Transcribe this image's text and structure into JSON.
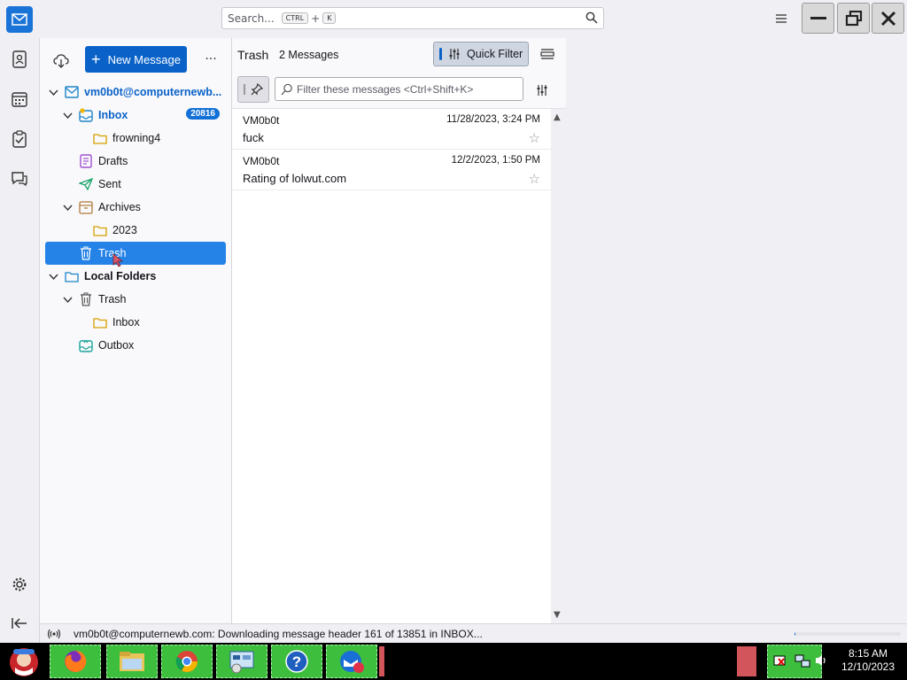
{
  "titlebar": {
    "search_placeholder": "Search...",
    "search_key1": "CTRL",
    "search_plus": "+",
    "search_key2": "K"
  },
  "folder_pane": {
    "new_message_label": "New Message",
    "more_label": "···",
    "folders": [
      {
        "label": "vm0b0t@computernewb...",
        "bold": true
      },
      {
        "label": "Inbox",
        "badge": "20816"
      },
      {
        "label": "frowning4"
      },
      {
        "label": "Drafts"
      },
      {
        "label": "Sent"
      },
      {
        "label": "Archives"
      },
      {
        "label": "2023"
      },
      {
        "label": "Trash",
        "selected": true
      },
      {
        "label": "Local Folders"
      },
      {
        "label": "Trash"
      },
      {
        "label": "Inbox"
      },
      {
        "label": "Outbox"
      }
    ]
  },
  "thread_pane": {
    "folder_title": "Trash",
    "message_count": "2 Messages",
    "quick_filter_label": "Quick Filter",
    "filter_placeholder": "Filter these messages <Ctrl+Shift+K>",
    "messages": [
      {
        "from": "VM0b0t",
        "date": "11/28/2023, 3:24 PM",
        "subject": "fuck"
      },
      {
        "from": "VM0b0t",
        "date": "12/2/2023, 1:50 PM",
        "subject": "Rating of lolwut.com"
      }
    ]
  },
  "status_bar": {
    "text": "vm0b0t@computernewb.com: Downloading message header 161 of 13851 in INBOX...",
    "progress_fraction": 0.012
  },
  "taskbar": {
    "time": "8:15 AM",
    "date": "12/10/2023"
  },
  "colors": {
    "accent": "#0a62c9",
    "selected_row": "#2583e8",
    "taskbar_item": "#3dbf3d"
  }
}
